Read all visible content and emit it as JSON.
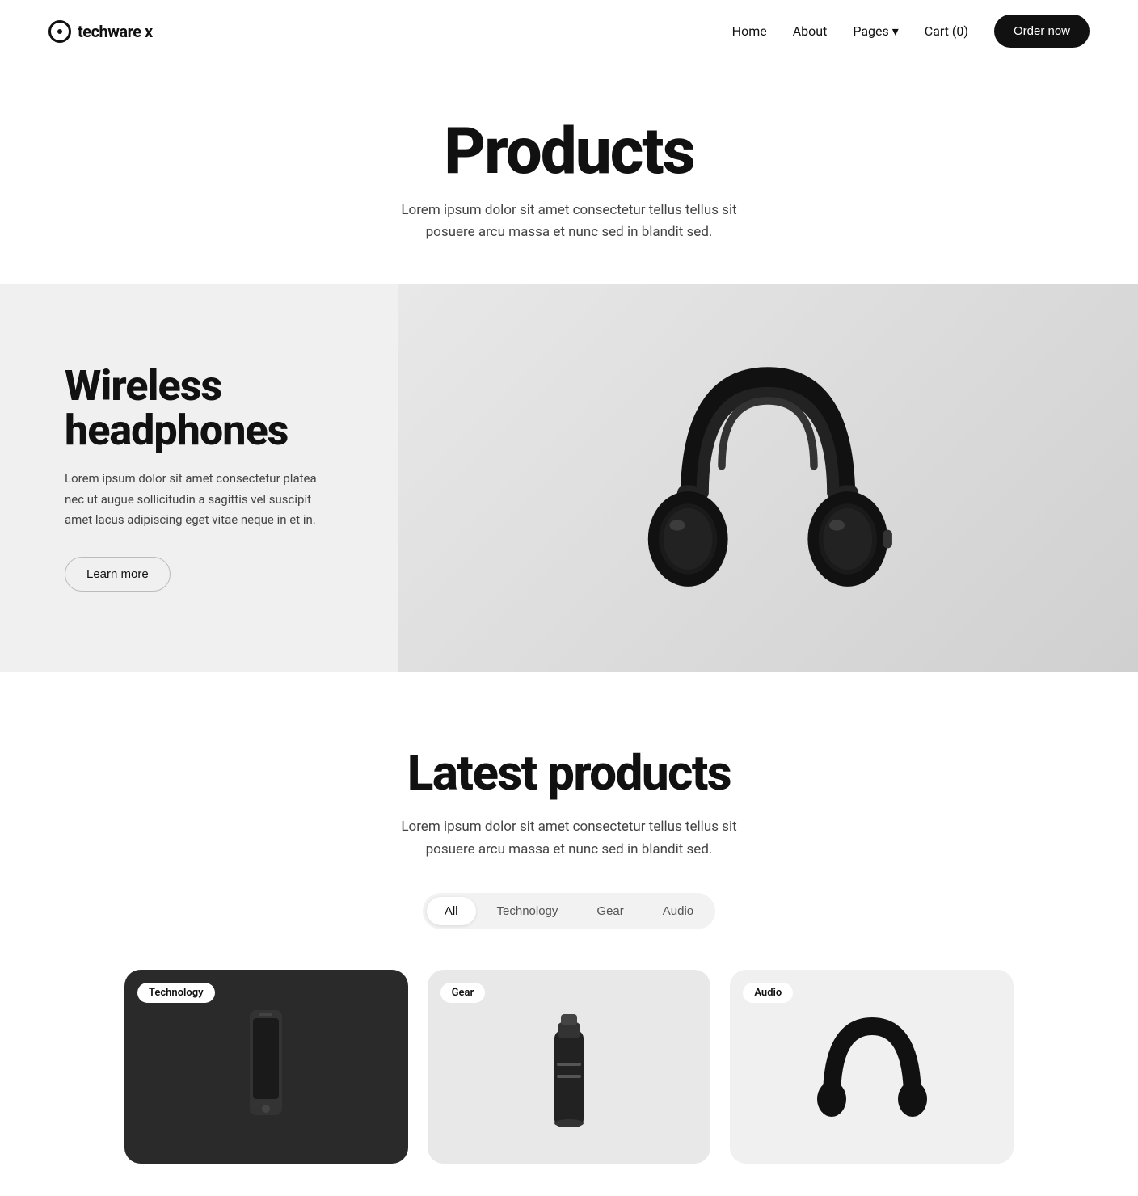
{
  "brand": {
    "name": "techware x",
    "logo_symbol": "O"
  },
  "nav": {
    "home": "Home",
    "about": "About",
    "pages": "Pages",
    "cart": "Cart (0)",
    "order_now": "Order now"
  },
  "hero": {
    "title": "Products",
    "subtitle": "Lorem ipsum dolor sit amet consectetur tellus tellus sit posuere arcu massa et nunc sed in blandit sed."
  },
  "banner": {
    "title_line1": "Wireless",
    "title_line2": "headphones",
    "description": "Lorem ipsum dolor sit amet consectetur platea nec ut augue sollicitudin a sagittis vel suscipit amet lacus adipiscing eget vitae neque in et in.",
    "cta": "Learn more"
  },
  "latest": {
    "title": "Latest products",
    "subtitle": "Lorem ipsum dolor sit amet consectetur tellus tellus sit posuere arcu massa et nunc sed in blandit sed."
  },
  "filters": {
    "tabs": [
      {
        "label": "All",
        "active": true
      },
      {
        "label": "Technology",
        "active": false
      },
      {
        "label": "Gear",
        "active": false
      },
      {
        "label": "Audio",
        "active": false
      }
    ]
  },
  "products": [
    {
      "badge": "Technology",
      "type": "tech"
    },
    {
      "badge": "Gear",
      "type": "gear"
    },
    {
      "badge": "Audio",
      "type": "audio"
    }
  ],
  "colors": {
    "primary": "#111111",
    "bg_light": "#f5f5f5",
    "bg_banner": "#f0f0f0"
  }
}
